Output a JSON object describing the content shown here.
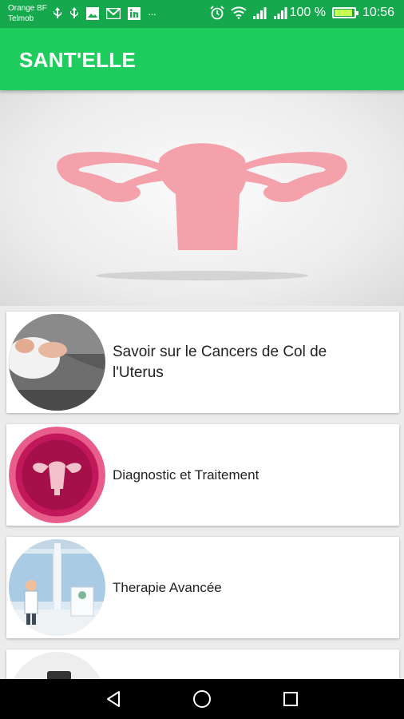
{
  "status_bar": {
    "carrier_line1": "Orange BF",
    "carrier_line2": "Telmob",
    "signal_percent": "100 %",
    "time": "10:56",
    "battery_level": 1.0,
    "left_icons": [
      "usb-icon",
      "usb-icon",
      "image-icon",
      "gmail-icon",
      "linkedin-icon",
      "more-icon"
    ],
    "right_icons": [
      "alarm-icon",
      "wifi-icon",
      "signal-icon",
      "signal-icon",
      "battery-icon"
    ],
    "more_glyph": "···"
  },
  "app_bar": {
    "title": "SANT'ELLE"
  },
  "hero": {
    "image": "uterus-illustration",
    "color": "#f4a1ab"
  },
  "menu_items": [
    {
      "label": "Savoir sur le Cancers de Col de l'Uterus",
      "thumbnail": "woman-abdominal-pain-photo"
    },
    {
      "label": "Diagnostic et Traitement",
      "thumbnail": "uterus-badge-illustration"
    },
    {
      "label": "Therapie Avancée",
      "thumbnail": "hospital-doctor-illustration"
    },
    {
      "label": "",
      "thumbnail": "partial-item-thumbnail"
    }
  ],
  "nav_bar": {
    "buttons": [
      "back-icon",
      "home-icon",
      "recents-icon"
    ]
  },
  "colors": {
    "status_bar": "#15a84d",
    "app_bar": "#1fcd5f",
    "accent_pink": "#f4a1ab",
    "badge_pink": "#c2185b"
  }
}
